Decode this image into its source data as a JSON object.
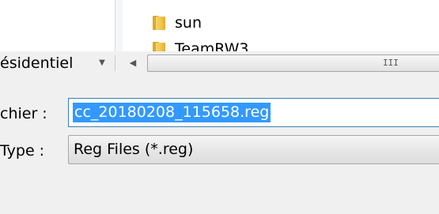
{
  "file_list": {
    "items": [
      {
        "name": "sun",
        "icon": "folder-icon"
      },
      {
        "name": "TeamRW3",
        "icon": "folder-icon"
      }
    ]
  },
  "location": {
    "label": "ésidentiel",
    "dropdown_icon": "chevron-down-icon"
  },
  "hscroll": {
    "left_arrow": "◀",
    "grip": "III"
  },
  "form": {
    "filename_label": "chier :",
    "filename_value": "cc_20180208_115658.reg",
    "filetype_label": "Type :",
    "filetype_value": "Reg Files (*.reg)"
  },
  "colors": {
    "selection": "#3399ff",
    "input_border": "#3c7fb1",
    "folder": "#f0c44a",
    "background": "#f0f0f0"
  }
}
